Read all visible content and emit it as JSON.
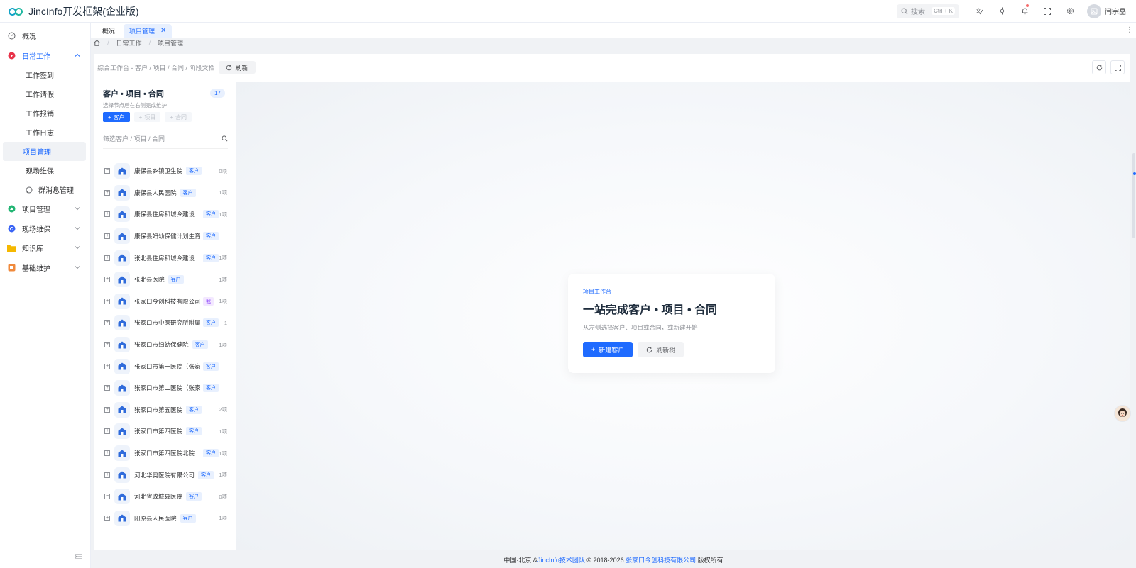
{
  "app": {
    "title": "JincInfo开发框架(企业版)"
  },
  "header": {
    "search_placeholder": "搜索",
    "search_shortcut": "Ctrl + K",
    "username": "闫宗晶"
  },
  "sidebar": {
    "items": [
      {
        "label": "概况",
        "icon": "dashboard-icon"
      },
      {
        "label": "日常工作",
        "icon": "daily-work-icon",
        "expanded": true,
        "children": [
          "工作签到",
          "工作请假",
          "工作报销",
          "工作日志",
          "项目管理",
          "现场维保"
        ],
        "nested": "群消息管理"
      },
      {
        "label": "项目管理",
        "icon": "project-icon"
      },
      {
        "label": "现场维保",
        "icon": "maintenance-icon"
      },
      {
        "label": "知识库",
        "icon": "folder-icon"
      },
      {
        "label": "基础维护",
        "icon": "base-icon"
      }
    ]
  },
  "tabs": [
    {
      "label": "概况"
    },
    {
      "label": "项目管理",
      "active": true
    }
  ],
  "breadcrumb": [
    "日常工作",
    "项目管理"
  ],
  "toolbar": {
    "path": "综合工作台 - 客户 / 项目 / 合同 / 阶段文档",
    "refresh_label": "刷新"
  },
  "tree": {
    "title": "客户 • 项目 • 合同",
    "subtitle": "选择节点后在右侧完成维护",
    "count": "17",
    "add_customer": "客户",
    "add_project": "项目",
    "add_contract": "合同",
    "filter_placeholder": "筛选客户 / 项目 / 合同",
    "nodes": [
      {
        "name": "康保县乡镇卫生院",
        "tag": "客户",
        "count": "0项",
        "exp": "−"
      },
      {
        "name": "康保县人民医院",
        "tag": "客户",
        "count": "1项",
        "exp": "+"
      },
      {
        "name": "康保县住房和城乡建设...",
        "tag": "客户",
        "count": "1项",
        "exp": "+"
      },
      {
        "name": "康保县妇幼保健计划生育服...",
        "tag": "客户",
        "count": "",
        "exp": "+"
      },
      {
        "name": "张北县住房和城乡建设...",
        "tag": "客户",
        "count": "1项",
        "exp": "+"
      },
      {
        "name": "张北县医院",
        "tag": "客户",
        "count": "1项",
        "exp": "+"
      },
      {
        "name": "张家口今创科技有限公司",
        "tag": "我",
        "count": "1项",
        "exp": "+",
        "tag_style": "purple"
      },
      {
        "name": "张家口市中医研究所附属...",
        "tag": "客户",
        "count": "1",
        "exp": "+"
      },
      {
        "name": "张家口市妇幼保健院",
        "tag": "客户",
        "count": "1项",
        "exp": "+"
      },
      {
        "name": "张家口市第一医院（张家口...",
        "tag": "客户",
        "count": "",
        "exp": "+"
      },
      {
        "name": "张家口市第二医院（张家口...",
        "tag": "客户",
        "count": "",
        "exp": "+"
      },
      {
        "name": "张家口市第五医院",
        "tag": "客户",
        "count": "2项",
        "exp": "+"
      },
      {
        "name": "张家口市第四医院",
        "tag": "客户",
        "count": "1项",
        "exp": "+"
      },
      {
        "name": "张家口市第四医院北院...",
        "tag": "客户",
        "count": "1项",
        "exp": "+"
      },
      {
        "name": "河北华奥医院有限公司",
        "tag": "客户",
        "count": "1项",
        "exp": "+"
      },
      {
        "name": "河北省政城县医院",
        "tag": "客户",
        "count": "0项",
        "exp": "−"
      },
      {
        "name": "阳原县人民医院",
        "tag": "客户",
        "count": "1项",
        "exp": "+"
      }
    ]
  },
  "welcome": {
    "kicker": "项目工作台",
    "title": "一站完成客户 • 项目 • 合同",
    "desc": "从左侧选择客户、项目或合同，或新建开始",
    "new_customer": "新建客户",
    "refresh_tree": "刷新树"
  },
  "footer": {
    "prefix": "中国·北京 & ",
    "team": "JincInfo技术团队",
    "copyright": " © 2018-2026 ",
    "company": "张家口今创科技有限公司",
    "suffix": " 版权所有"
  },
  "colors": {
    "primary": "#1f6bff",
    "logo": "#14a3c7"
  }
}
